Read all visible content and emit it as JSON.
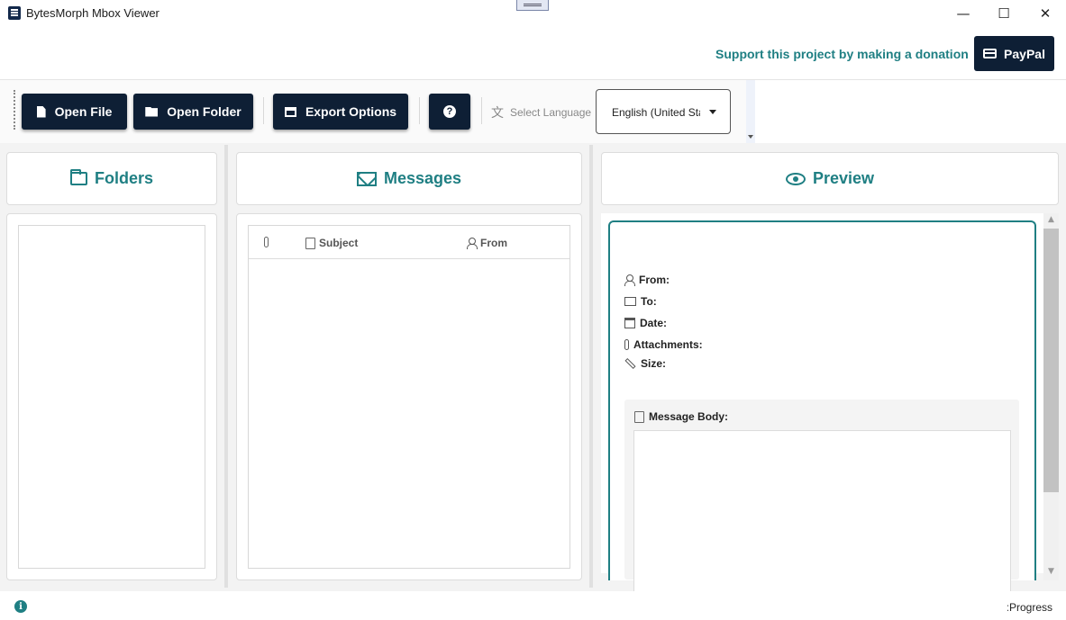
{
  "window": {
    "title": "BytesMorph Mbox Viewer",
    "controls": {
      "minimize": "—",
      "maximize": "☐",
      "close": "✕"
    }
  },
  "donation": {
    "text": "Support this project by making a donation",
    "paypal_label": "PayPal"
  },
  "toolbar": {
    "open_file": "Open File",
    "open_folder": "Open Folder",
    "export_options": "Export Options",
    "help_glyph": "?",
    "language_label": "Select Language",
    "language_value": "English (United States)"
  },
  "panels": {
    "folders": {
      "title": "Folders"
    },
    "messages": {
      "title": "Messages",
      "columns": {
        "subject": "Subject",
        "from": "From"
      }
    },
    "preview": {
      "title": "Preview",
      "fields": {
        "from": "From:",
        "to": "To:",
        "date": "Date:",
        "attachments": "Attachments:",
        "size": "Size:"
      },
      "message_body_label": "Message Body:"
    }
  },
  "statusbar": {
    "info_glyph": "i",
    "progress_label": "Progress:"
  },
  "icons": {
    "app": "app-icon",
    "paypal": "card-icon",
    "open_file": "document-icon",
    "open_folder": "folder-icon",
    "export": "store-icon",
    "help": "question-icon",
    "language": "translate-icon",
    "folders": "folder-icon",
    "messages": "mail-icon",
    "preview": "eye-icon"
  },
  "colors": {
    "brand_dark": "#0e1f35",
    "accent_teal": "#1f7f83"
  }
}
